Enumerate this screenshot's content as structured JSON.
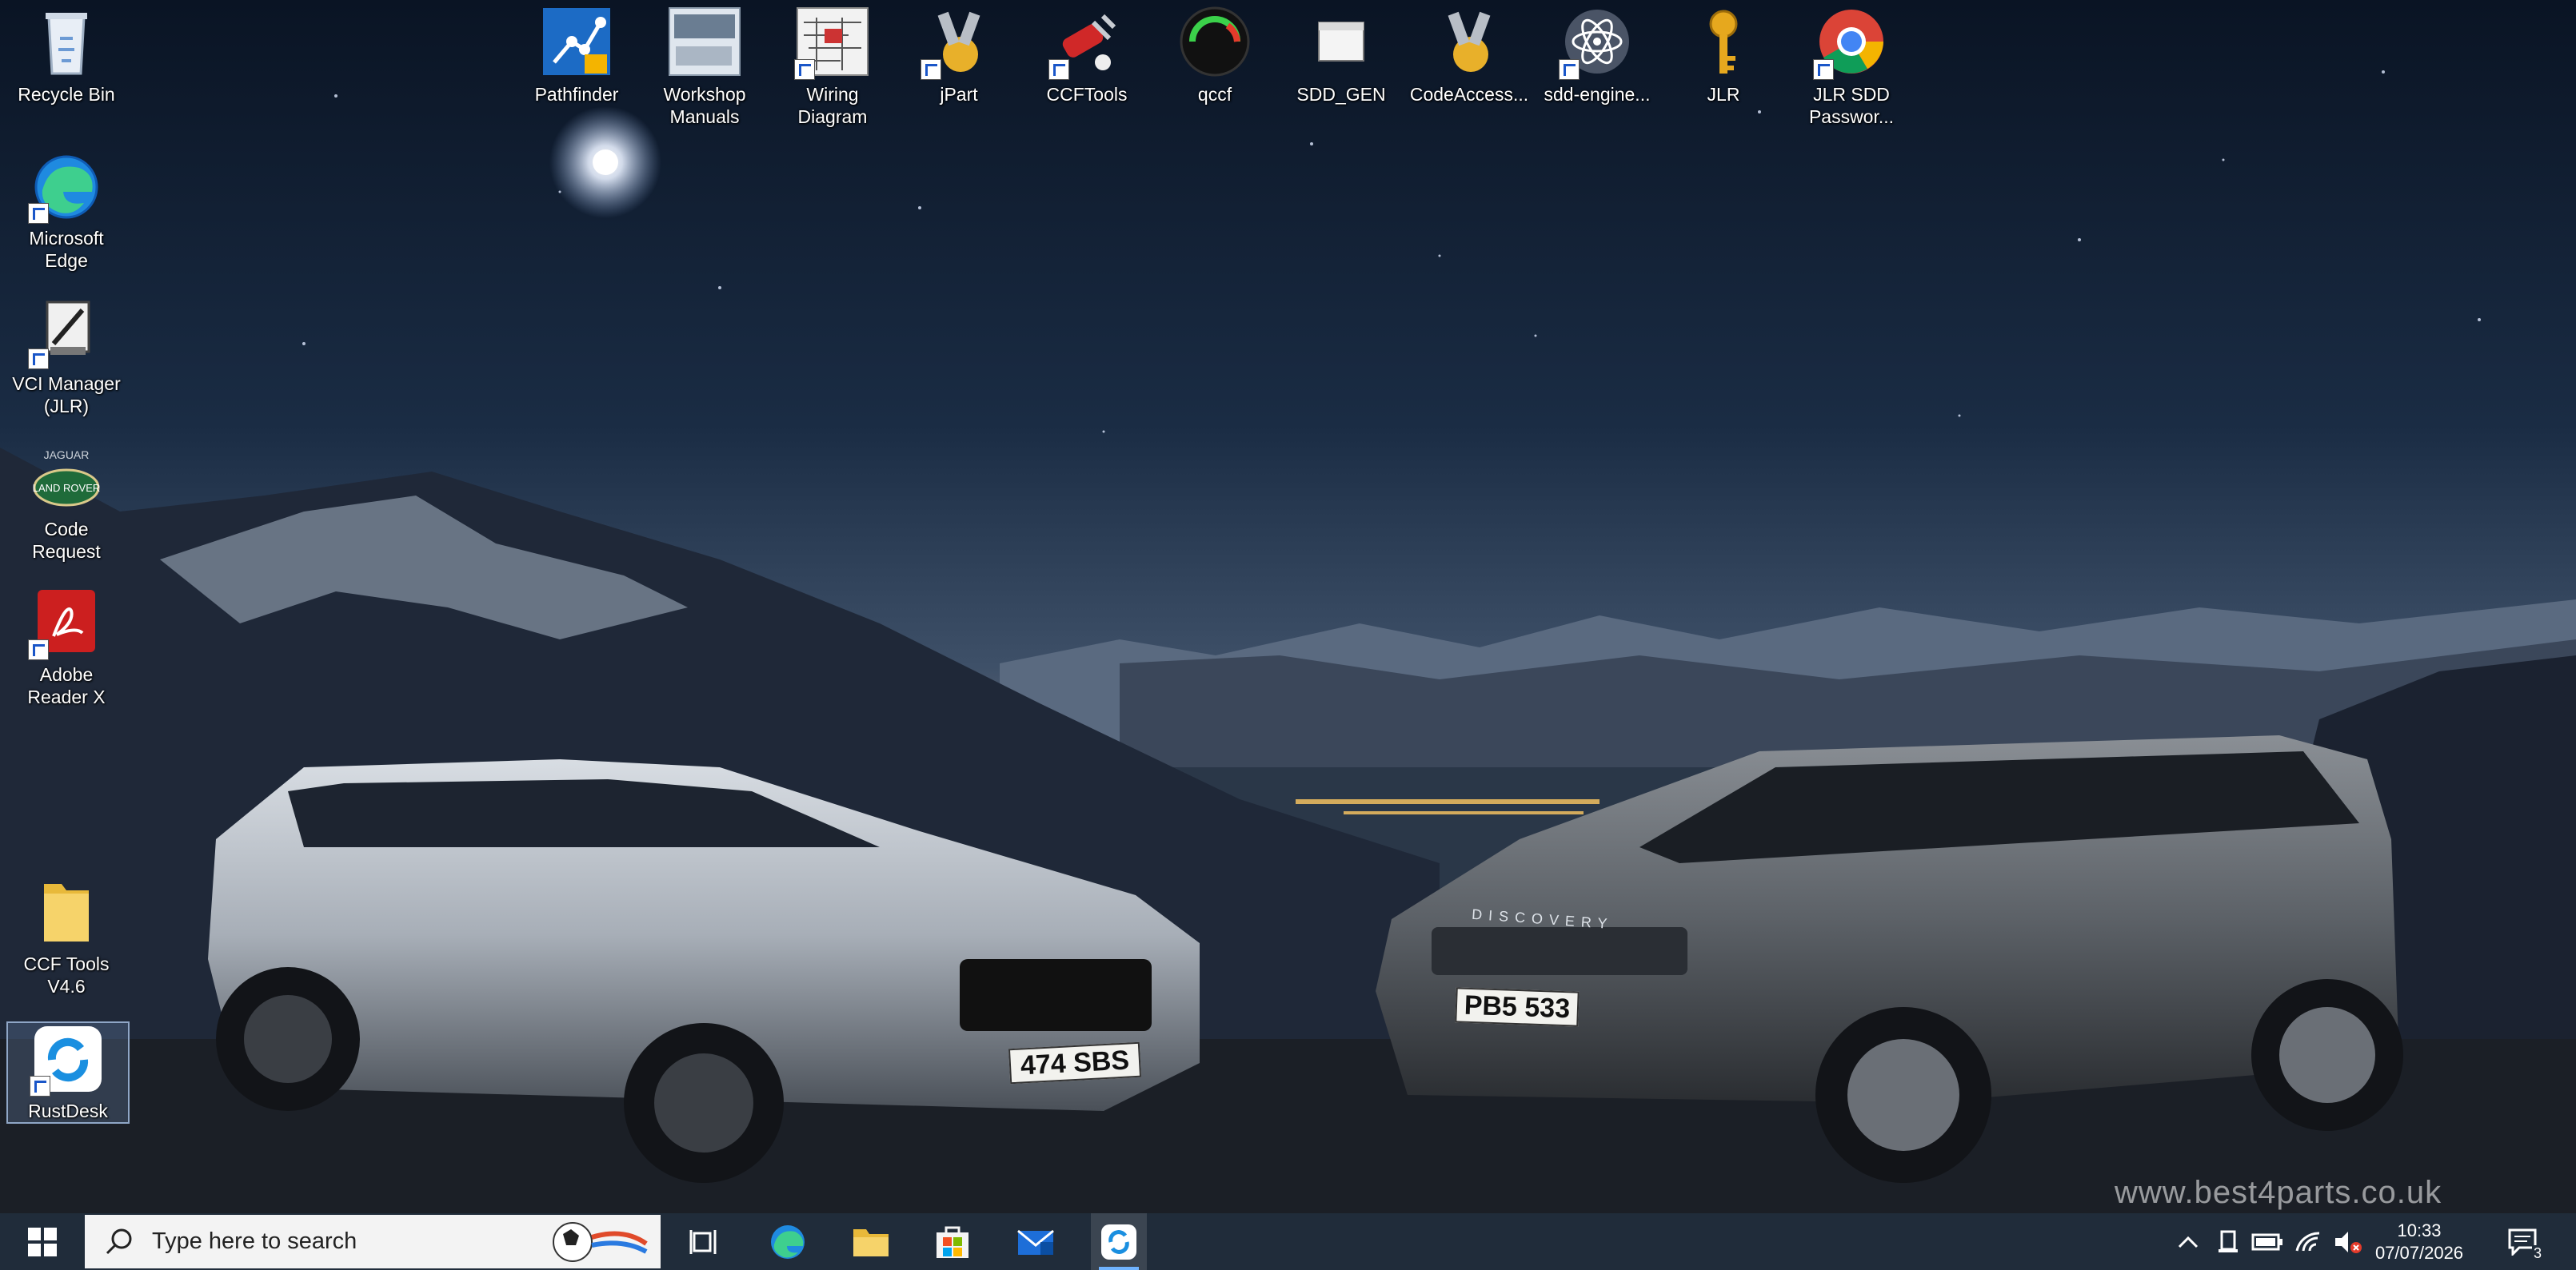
{
  "desktop": {
    "top_icons": [
      {
        "label": "Pathfinder"
      },
      {
        "label": "Workshop\nManuals"
      },
      {
        "label": "Wiring\nDiagram"
      },
      {
        "label": "jPart"
      },
      {
        "label": "CCFTools"
      },
      {
        "label": "qccf"
      },
      {
        "label": "SDD_GEN"
      },
      {
        "label": "CodeAccess..."
      },
      {
        "label": "sdd-engine..."
      },
      {
        "label": "JLR"
      },
      {
        "label": "JLR SDD\nPasswor..."
      }
    ],
    "left_icons": [
      {
        "label": "Recycle Bin"
      },
      {
        "label": "Microsoft\nEdge"
      },
      {
        "label": "VCI Manager\n(JLR)"
      },
      {
        "label": "Code\nRequest"
      },
      {
        "label": "Adobe\nReader X"
      },
      {
        "label": "CCF Tools\nV4.6"
      },
      {
        "label": "RustDesk"
      }
    ],
    "wallpaper": {
      "watermark": "www.best4parts.co.uk",
      "plate_left": "474 SBS",
      "plate_right": "PB5 533",
      "badge_right": "DISCOVERY"
    }
  },
  "taskbar": {
    "search_placeholder": "Type here to search",
    "pinned": [
      "task-view",
      "edge",
      "file-explorer",
      "microsoft-store",
      "mail",
      "rustdesk"
    ],
    "clock_time": "10:33",
    "clock_date": "07/07/2026",
    "notification_count": "3"
  },
  "colors": {
    "taskbar_bg": "#202c3a",
    "search_bg": "#f3f3f3",
    "sky_top": "#0a1424",
    "horizon": "#c98a5a"
  }
}
